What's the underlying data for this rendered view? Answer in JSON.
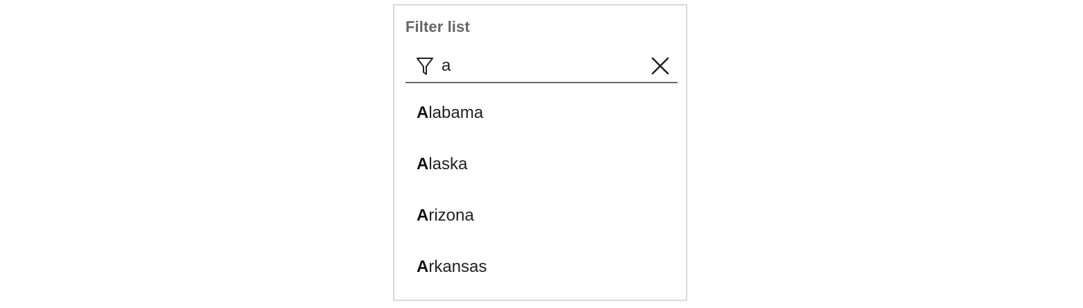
{
  "filter": {
    "label": "Filter list",
    "value": "a",
    "icon": "filter-icon",
    "clear_icon": "close-icon"
  },
  "list": {
    "items": [
      {
        "match": "A",
        "rest": "labama"
      },
      {
        "match": "A",
        "rest": "laska"
      },
      {
        "match": "A",
        "rest": "rizona"
      },
      {
        "match": "A",
        "rest": "rkansas"
      }
    ]
  },
  "colors": {
    "border": "#d8d8d8",
    "underline": "#6b6b6b",
    "label": "#666666",
    "text": "#222222"
  }
}
